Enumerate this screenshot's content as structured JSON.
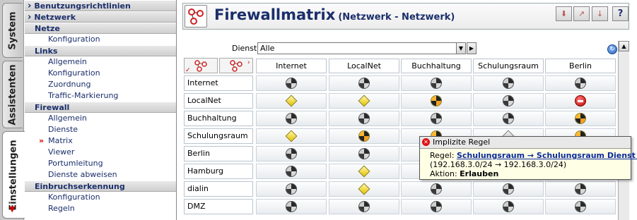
{
  "vertical_tabs": [
    {
      "label": "System",
      "active": false
    },
    {
      "label": "Assistenten",
      "active": false
    },
    {
      "label": "Einstellungen",
      "active": true
    }
  ],
  "nav": {
    "sections": [
      {
        "label": "Benutzungsrichtlinien",
        "arrow": true,
        "items": []
      },
      {
        "label": "Netzwerk",
        "arrow": true,
        "items": []
      },
      {
        "label": "Netze",
        "items": [
          "Konfiguration"
        ]
      },
      {
        "label": "Links",
        "items": [
          "Allgemein",
          "Konfiguration",
          "Zuordnung",
          "Traffic-Markierung"
        ]
      },
      {
        "label": "Firewall",
        "items": [
          "Allgemein",
          "Dienste",
          "Matrix",
          "Viewer",
          "Portumleitung",
          "Dienste abweisen"
        ],
        "current": "Matrix"
      },
      {
        "label": "Einbruchserkennung",
        "items": [
          "Konfiguration",
          "Regeln"
        ]
      }
    ]
  },
  "header": {
    "title": "Firewallmatrix",
    "subtitle": "(Netzwerk - Netzwerk)",
    "toolbar_icons": [
      "import-icon",
      "export-icon",
      "download-icon",
      "help-icon"
    ],
    "help_label": "?"
  },
  "filter": {
    "label": "Dienst",
    "value": "Alle"
  },
  "matrix": {
    "columns": [
      "Internet",
      "LocalNet",
      "Buchhaltung",
      "Schulungsraum",
      "Berlin"
    ],
    "rows": [
      {
        "name": "Internet",
        "cells": [
          "gray",
          "gray",
          "gray",
          "gray",
          "gray"
        ]
      },
      {
        "name": "LocalNet",
        "cells": [
          "diamond",
          "diamond",
          "orange",
          "gray",
          "stop"
        ]
      },
      {
        "name": "Buchhaltung",
        "cells": [
          "gray",
          "gray",
          "gray",
          "gray",
          "orange"
        ]
      },
      {
        "name": "Schulungsraum",
        "cells": [
          "diamond",
          "orange",
          "orange",
          "diamond-gray",
          "orange"
        ]
      },
      {
        "name": "Berlin",
        "cells": [
          "gray",
          "gray",
          "gray",
          "gray",
          "gray"
        ]
      },
      {
        "name": "Hamburg",
        "cells": [
          "gray",
          "diamond",
          "gray",
          "gray",
          "gray"
        ]
      },
      {
        "name": "dialin",
        "cells": [
          "gray",
          "diamond",
          "gray",
          "gray",
          "gray"
        ]
      },
      {
        "name": "DMZ",
        "cells": [
          "gray",
          "gray",
          "gray",
          "gray",
          "gray"
        ]
      }
    ],
    "icon_colors": {
      "orange": "#f5a020",
      "diamond": "#e3c200",
      "stop": "#c40000"
    }
  },
  "tooltip": {
    "title": "Implizite Regel",
    "rule_prefix": "Regel:",
    "rule_link": "Schulungsraum → Schulungsraum Dienst any",
    "addresses": "(192.168.3.0/24 → 192.168.3.0/24)",
    "action_prefix": "Aktion:",
    "action_value": "Erlauben"
  }
}
